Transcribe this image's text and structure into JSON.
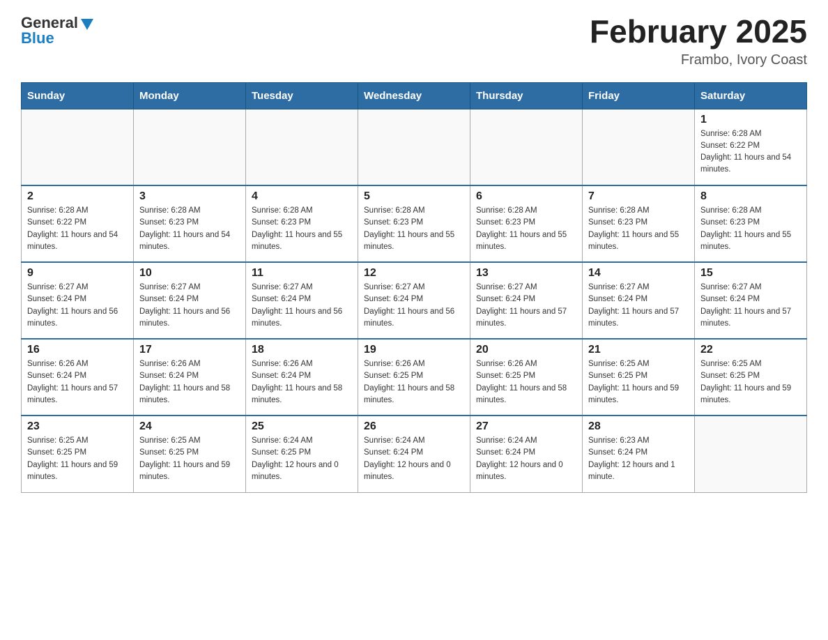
{
  "header": {
    "logo": {
      "general": "General",
      "arrow": "▲",
      "blue": "Blue"
    },
    "title": "February 2025",
    "location": "Frambo, Ivory Coast"
  },
  "calendar": {
    "days_of_week": [
      "Sunday",
      "Monday",
      "Tuesday",
      "Wednesday",
      "Thursday",
      "Friday",
      "Saturday"
    ],
    "weeks": [
      [
        {
          "day": "",
          "info": ""
        },
        {
          "day": "",
          "info": ""
        },
        {
          "day": "",
          "info": ""
        },
        {
          "day": "",
          "info": ""
        },
        {
          "day": "",
          "info": ""
        },
        {
          "day": "",
          "info": ""
        },
        {
          "day": "1",
          "info": "Sunrise: 6:28 AM\nSunset: 6:22 PM\nDaylight: 11 hours and 54 minutes."
        }
      ],
      [
        {
          "day": "2",
          "info": "Sunrise: 6:28 AM\nSunset: 6:22 PM\nDaylight: 11 hours and 54 minutes."
        },
        {
          "day": "3",
          "info": "Sunrise: 6:28 AM\nSunset: 6:23 PM\nDaylight: 11 hours and 54 minutes."
        },
        {
          "day": "4",
          "info": "Sunrise: 6:28 AM\nSunset: 6:23 PM\nDaylight: 11 hours and 55 minutes."
        },
        {
          "day": "5",
          "info": "Sunrise: 6:28 AM\nSunset: 6:23 PM\nDaylight: 11 hours and 55 minutes."
        },
        {
          "day": "6",
          "info": "Sunrise: 6:28 AM\nSunset: 6:23 PM\nDaylight: 11 hours and 55 minutes."
        },
        {
          "day": "7",
          "info": "Sunrise: 6:28 AM\nSunset: 6:23 PM\nDaylight: 11 hours and 55 minutes."
        },
        {
          "day": "8",
          "info": "Sunrise: 6:28 AM\nSunset: 6:23 PM\nDaylight: 11 hours and 55 minutes."
        }
      ],
      [
        {
          "day": "9",
          "info": "Sunrise: 6:27 AM\nSunset: 6:24 PM\nDaylight: 11 hours and 56 minutes."
        },
        {
          "day": "10",
          "info": "Sunrise: 6:27 AM\nSunset: 6:24 PM\nDaylight: 11 hours and 56 minutes."
        },
        {
          "day": "11",
          "info": "Sunrise: 6:27 AM\nSunset: 6:24 PM\nDaylight: 11 hours and 56 minutes."
        },
        {
          "day": "12",
          "info": "Sunrise: 6:27 AM\nSunset: 6:24 PM\nDaylight: 11 hours and 56 minutes."
        },
        {
          "day": "13",
          "info": "Sunrise: 6:27 AM\nSunset: 6:24 PM\nDaylight: 11 hours and 57 minutes."
        },
        {
          "day": "14",
          "info": "Sunrise: 6:27 AM\nSunset: 6:24 PM\nDaylight: 11 hours and 57 minutes."
        },
        {
          "day": "15",
          "info": "Sunrise: 6:27 AM\nSunset: 6:24 PM\nDaylight: 11 hours and 57 minutes."
        }
      ],
      [
        {
          "day": "16",
          "info": "Sunrise: 6:26 AM\nSunset: 6:24 PM\nDaylight: 11 hours and 57 minutes."
        },
        {
          "day": "17",
          "info": "Sunrise: 6:26 AM\nSunset: 6:24 PM\nDaylight: 11 hours and 58 minutes."
        },
        {
          "day": "18",
          "info": "Sunrise: 6:26 AM\nSunset: 6:24 PM\nDaylight: 11 hours and 58 minutes."
        },
        {
          "day": "19",
          "info": "Sunrise: 6:26 AM\nSunset: 6:25 PM\nDaylight: 11 hours and 58 minutes."
        },
        {
          "day": "20",
          "info": "Sunrise: 6:26 AM\nSunset: 6:25 PM\nDaylight: 11 hours and 58 minutes."
        },
        {
          "day": "21",
          "info": "Sunrise: 6:25 AM\nSunset: 6:25 PM\nDaylight: 11 hours and 59 minutes."
        },
        {
          "day": "22",
          "info": "Sunrise: 6:25 AM\nSunset: 6:25 PM\nDaylight: 11 hours and 59 minutes."
        }
      ],
      [
        {
          "day": "23",
          "info": "Sunrise: 6:25 AM\nSunset: 6:25 PM\nDaylight: 11 hours and 59 minutes."
        },
        {
          "day": "24",
          "info": "Sunrise: 6:25 AM\nSunset: 6:25 PM\nDaylight: 11 hours and 59 minutes."
        },
        {
          "day": "25",
          "info": "Sunrise: 6:24 AM\nSunset: 6:25 PM\nDaylight: 12 hours and 0 minutes."
        },
        {
          "day": "26",
          "info": "Sunrise: 6:24 AM\nSunset: 6:24 PM\nDaylight: 12 hours and 0 minutes."
        },
        {
          "day": "27",
          "info": "Sunrise: 6:24 AM\nSunset: 6:24 PM\nDaylight: 12 hours and 0 minutes."
        },
        {
          "day": "28",
          "info": "Sunrise: 6:23 AM\nSunset: 6:24 PM\nDaylight: 12 hours and 1 minute."
        },
        {
          "day": "",
          "info": ""
        }
      ]
    ]
  }
}
